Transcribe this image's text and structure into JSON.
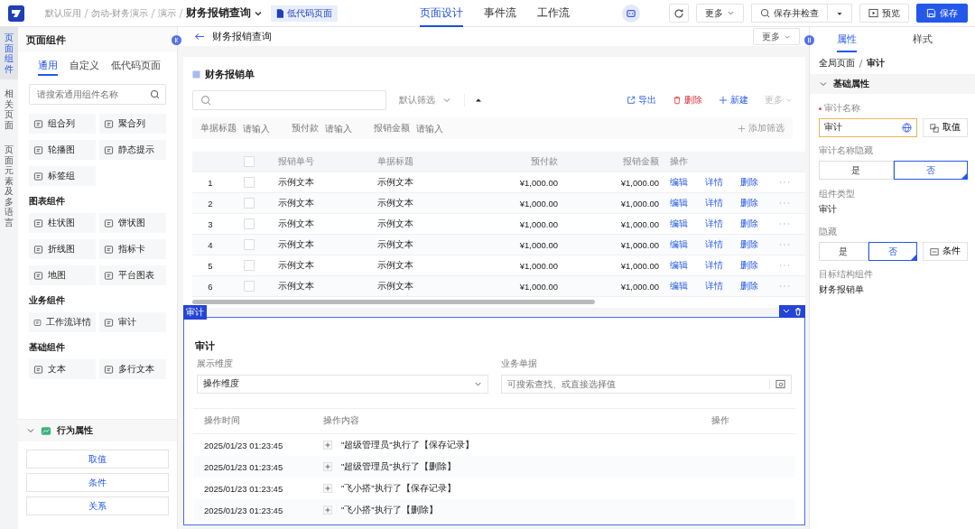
{
  "topbar": {
    "breadcrumb": [
      "默认应用",
      "勿动-财务演示",
      "演示"
    ],
    "page_title": "财务报销查询",
    "page_tag": "低代码页面",
    "tabs": [
      {
        "label": "页面设计",
        "selected": true
      },
      {
        "label": "事件流",
        "selected": false
      },
      {
        "label": "工作流",
        "selected": false
      }
    ],
    "more": "更多",
    "check": "保存并检查",
    "preview": "预览",
    "save": "保存"
  },
  "rail": [
    {
      "label": "页面组件",
      "selected": true
    },
    {
      "label": "相关页面",
      "selected": false
    },
    {
      "label": "页面元素及多语言",
      "selected": false
    }
  ],
  "component_panel": {
    "title": "页面组件",
    "tabs": [
      {
        "label": "通用",
        "selected": true
      },
      {
        "label": "自定义",
        "selected": false
      },
      {
        "label": "低代码页面",
        "selected": false
      }
    ],
    "search_placeholder": "请搜索通用组件名称",
    "groups": [
      {
        "items": [
          "组合列",
          "聚合列",
          "轮播图",
          "静态提示",
          "标签组"
        ]
      },
      {
        "title": "图表组件",
        "items": [
          "柱状图",
          "饼状图",
          "折线图",
          "指标卡",
          "地图",
          "平台图表"
        ]
      },
      {
        "title": "业务组件",
        "items": [
          "工作流详情",
          "审计"
        ]
      },
      {
        "title": "基础组件",
        "items": [
          "文本",
          "多行文本"
        ]
      }
    ]
  },
  "behavior": {
    "title": "行为属性",
    "expanded": true,
    "buttons": [
      "取值",
      "条件",
      "关系"
    ]
  },
  "canvas": {
    "title": "财务报销查询",
    "more": "更多",
    "list_card": {
      "title": "财务报销单",
      "filter": "默认筛选",
      "actions": [
        {
          "label": "导出",
          "kind": "export"
        },
        {
          "label": "删除",
          "kind": "delete"
        },
        {
          "label": "新建",
          "kind": "create"
        },
        {
          "label": "更多",
          "kind": "more"
        }
      ],
      "filters": [
        {
          "label": "单据标题",
          "placeholder": "请输入"
        },
        {
          "label": "预付款",
          "placeholder": "请输入"
        },
        {
          "label": "报销金额",
          "placeholder": "请输入"
        }
      ],
      "add_filter": "添加筛选",
      "header_checked": false,
      "columns": [
        "报销单号",
        "单据标题",
        "预付款",
        "报销金额",
        "操作"
      ],
      "rows": [
        {
          "index": "1",
          "checked": false,
          "cells": [
            "示例文本",
            "示例文本",
            "¥1,000.00",
            "¥1,000.00"
          ],
          "actions": [
            "编辑",
            "详情",
            "删除"
          ]
        },
        {
          "index": "2",
          "checked": false,
          "cells": [
            "示例文本",
            "示例文本",
            "¥1,000.00",
            "¥1,000.00"
          ],
          "actions": [
            "编辑",
            "详情",
            "删除"
          ]
        },
        {
          "index": "3",
          "checked": false,
          "cells": [
            "示例文本",
            "示例文本",
            "¥1,000.00",
            "¥1,000.00"
          ],
          "actions": [
            "编辑",
            "详情",
            "删除"
          ]
        },
        {
          "index": "4",
          "checked": false,
          "cells": [
            "示例文本",
            "示例文本",
            "¥1,000.00",
            "¥1,000.00"
          ],
          "actions": [
            "编辑",
            "详情",
            "删除"
          ]
        },
        {
          "index": "5",
          "checked": false,
          "cells": [
            "示例文本",
            "示例文本",
            "¥1,000.00",
            "¥1,000.00"
          ],
          "actions": [
            "编辑",
            "详情",
            "删除"
          ]
        },
        {
          "index": "6",
          "checked": false,
          "cells": [
            "示例文本",
            "示例文本",
            "¥1,000.00",
            "¥1,000.00"
          ],
          "actions": [
            "编辑",
            "详情",
            "删除"
          ]
        }
      ]
    },
    "audit": {
      "tag": "审计",
      "title": "审计",
      "dimension": {
        "label": "展示维度",
        "value": "操作维度"
      },
      "document": {
        "label": "业务单据",
        "placeholder": "可搜索查找、或直接选择值"
      },
      "columns": [
        "操作时间",
        "操作内容",
        "操作"
      ],
      "rows": [
        {
          "time": "2025/01/23 01:23:45",
          "content": "\"超级管理员\"执行了【保存记录】"
        },
        {
          "time": "2025/01/23 01:23:45",
          "content": "\"超级管理员\"执行了【删除】"
        },
        {
          "time": "2025/01/23 01:23:45",
          "content": "\"飞小搭\"执行了【保存记录】"
        },
        {
          "time": "2025/01/23 01:23:45",
          "content": "\"飞小搭\"执行了【删除】"
        }
      ]
    }
  },
  "props": {
    "tabs": [
      {
        "label": "属性",
        "selected": true
      },
      {
        "label": "样式",
        "selected": false
      }
    ],
    "breadcrumb": [
      "全局页面",
      "审计"
    ],
    "section": {
      "title": "基础属性",
      "expanded": true
    },
    "name": {
      "label": "审计名称",
      "required": true,
      "value": "审计",
      "button": "取值"
    },
    "name_hidden": {
      "label": "审计名称隐藏",
      "options": [
        {
          "label": "是",
          "selected": false
        },
        {
          "label": "否",
          "selected": true
        }
      ]
    },
    "type": {
      "label": "组件类型",
      "value": "审计"
    },
    "hidden": {
      "label": "隐藏",
      "options": [
        {
          "label": "是",
          "selected": false
        },
        {
          "label": "否",
          "selected": true
        }
      ],
      "button": "条件"
    },
    "target": {
      "label": "目标结构组件",
      "value": "财务报销单"
    }
  }
}
